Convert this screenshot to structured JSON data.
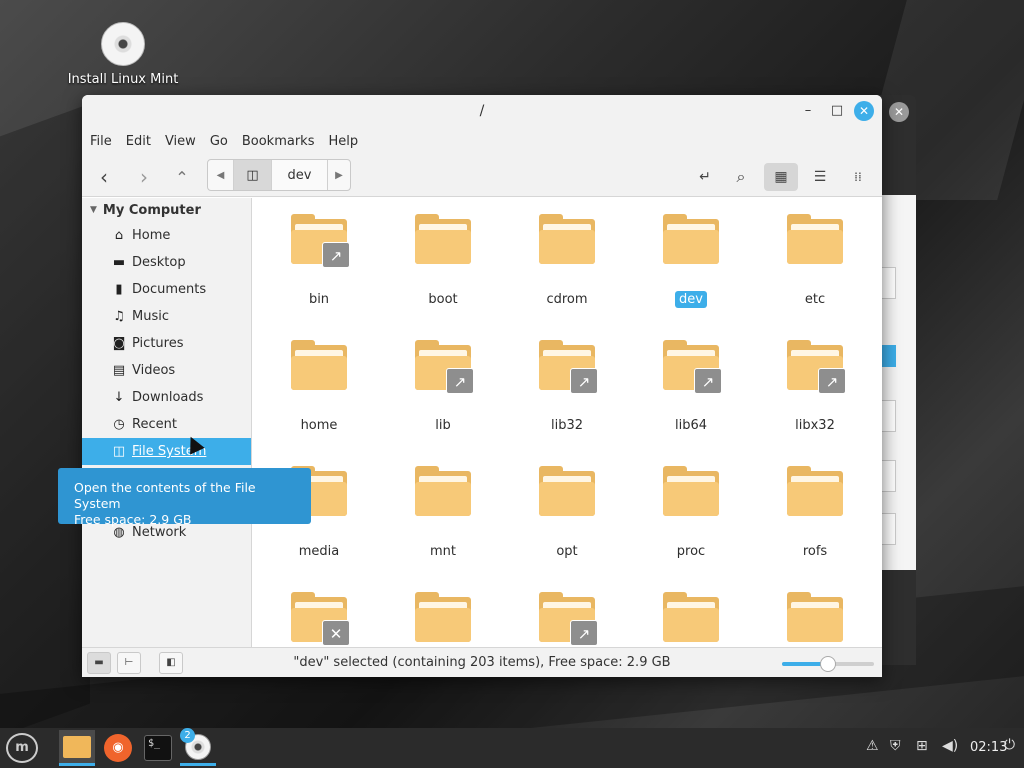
{
  "desktop": {
    "icon_label": "Install Linux Mint"
  },
  "window": {
    "title": "/",
    "controls": {
      "minimize": "–",
      "maximize": "□",
      "close": "✕"
    }
  },
  "menubar": [
    "File",
    "Edit",
    "View",
    "Go",
    "Bookmarks",
    "Help"
  ],
  "toolbar": {
    "back": "‹",
    "forward": "›",
    "up": "⌃",
    "path_segment": "dev",
    "location_icon": "↵",
    "search_icon": "⌕",
    "view_icons": "▦",
    "view_list": "☰",
    "view_compact": "⁞⁞"
  },
  "sidebar": {
    "header": "My Computer",
    "items": [
      {
        "label": "Home",
        "icon": "⌂"
      },
      {
        "label": "Desktop",
        "icon": "▬"
      },
      {
        "label": "Documents",
        "icon": "▮"
      },
      {
        "label": "Music",
        "icon": "♫"
      },
      {
        "label": "Pictures",
        "icon": "◙"
      },
      {
        "label": "Videos",
        "icon": "▤"
      },
      {
        "label": "Downloads",
        "icon": "↓"
      },
      {
        "label": "Recent",
        "icon": "◷"
      },
      {
        "label": "File System",
        "icon": "◫"
      }
    ],
    "network": {
      "label": "Network",
      "icon": "◍"
    }
  },
  "folders": [
    {
      "name": "bin",
      "emblem": "link"
    },
    {
      "name": "boot",
      "emblem": ""
    },
    {
      "name": "cdrom",
      "emblem": ""
    },
    {
      "name": "dev",
      "emblem": "",
      "selected": true
    },
    {
      "name": "etc",
      "emblem": ""
    },
    {
      "name": "home",
      "emblem": ""
    },
    {
      "name": "lib",
      "emblem": "link"
    },
    {
      "name": "lib32",
      "emblem": "link"
    },
    {
      "name": "lib64",
      "emblem": "link"
    },
    {
      "name": "libx32",
      "emblem": "link"
    },
    {
      "name": "media",
      "emblem": ""
    },
    {
      "name": "mnt",
      "emblem": ""
    },
    {
      "name": "opt",
      "emblem": ""
    },
    {
      "name": "proc",
      "emblem": ""
    },
    {
      "name": "rofs",
      "emblem": ""
    },
    {
      "name": "",
      "emblem": "unreadable"
    },
    {
      "name": "",
      "emblem": ""
    },
    {
      "name": "",
      "emblem": "link"
    },
    {
      "name": "",
      "emblem": ""
    },
    {
      "name": "",
      "emblem": ""
    }
  ],
  "tooltip": {
    "line1": "Open the contents of the File System",
    "line2": "Free space: 2.9 GB"
  },
  "statusbar": {
    "text": "\"dev\" selected (containing 203 items), Free space: 2.9 GB",
    "zoom_fraction": 0.5
  },
  "taskbar": {
    "menu_label": "m",
    "terminal_label": "$_",
    "disc_badge": "2",
    "clock": "02:13"
  },
  "colors": {
    "accent": "#3daee9",
    "folder": "#f7c978"
  }
}
